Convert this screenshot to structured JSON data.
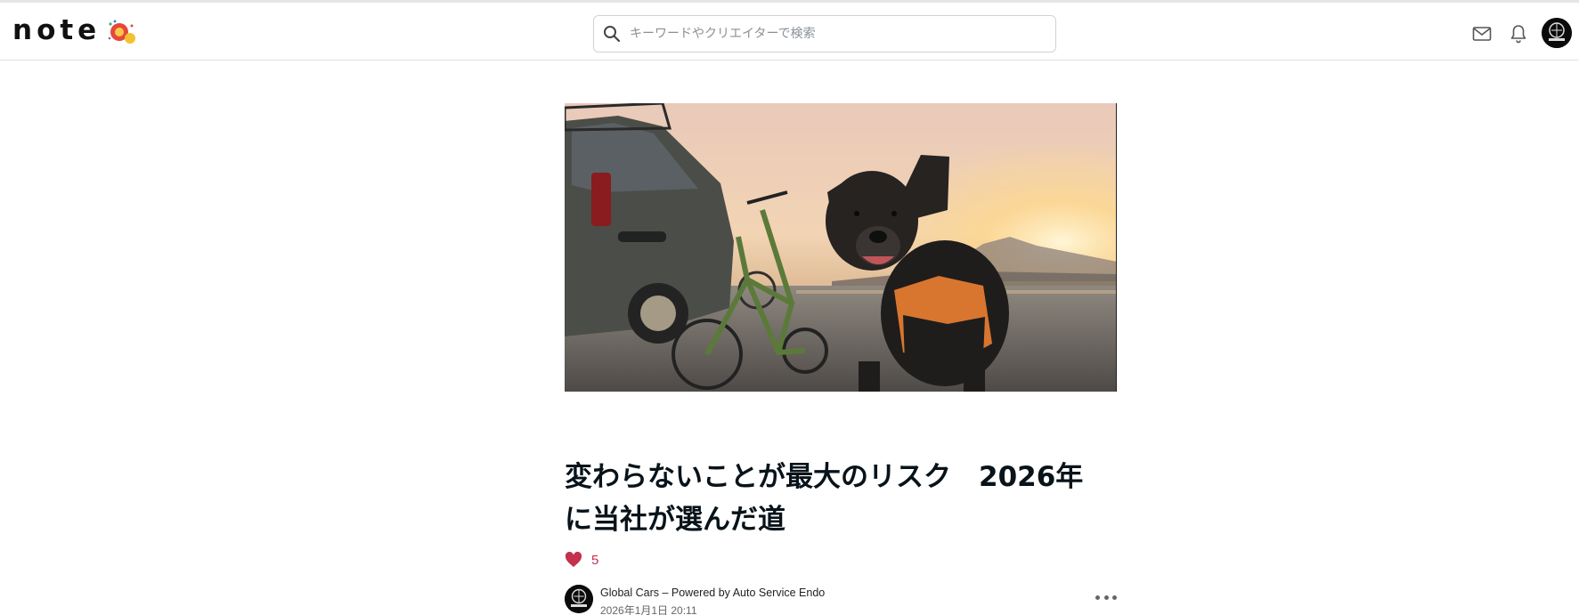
{
  "header": {
    "logo_text": "note",
    "search": {
      "placeholder": "キーワードやクリエイターで検索",
      "value": ""
    },
    "icons": [
      "search-icon",
      "mail-icon",
      "bell-icon",
      "user-avatar"
    ]
  },
  "article": {
    "hero_image": "sunset photo: black dog in orange vest, folding bicycle and van on a road, Mt. Fuji in the distance",
    "title_line1": "変わらないことが最大のリスク　2026年",
    "title_line2": "に当社が選んだ道",
    "like_count": "5",
    "author_name": "Global Cars – Powered by Auto Service Endo",
    "published_at": "2026年1月1日 20:11"
  },
  "colors": {
    "like": "#c4304e",
    "text": "#08131a",
    "border": "#e1e1e1"
  }
}
